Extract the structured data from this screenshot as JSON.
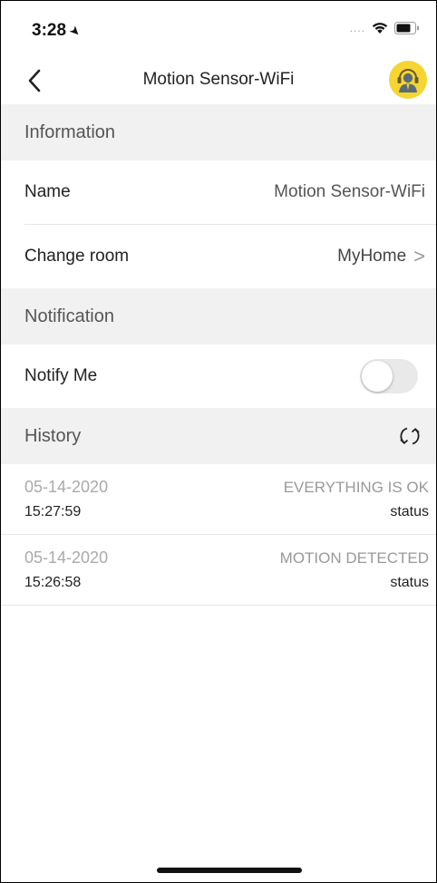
{
  "status_bar": {
    "time": "3:28",
    "location_arrow": "➤",
    "signal": "....",
    "icons": [
      "wifi-icon",
      "battery-icon"
    ]
  },
  "nav": {
    "back_icon": "chevron-left-icon",
    "title": "Motion Sensor-WiFi",
    "support_icon": "customer-support-icon",
    "accent_color": "#f5d531"
  },
  "sections": {
    "information": {
      "header": "Information",
      "name_label": "Name",
      "name_value": "Motion Sensor-WiFi",
      "room_label": "Change room",
      "room_value": "MyHome",
      "room_chevron": ">"
    },
    "notification": {
      "header": "Notification",
      "notify_label": "Notify Me",
      "notify_enabled": false
    },
    "history": {
      "header": "History",
      "refresh_icon": "refresh-icon",
      "items": [
        {
          "date": "05-14-2020",
          "time": "15:27:59",
          "event": "EVERYTHING IS OK",
          "type": "status"
        },
        {
          "date": "05-14-2020",
          "time": "15:26:58",
          "event": "MOTION DETECTED",
          "type": "status"
        }
      ]
    }
  }
}
